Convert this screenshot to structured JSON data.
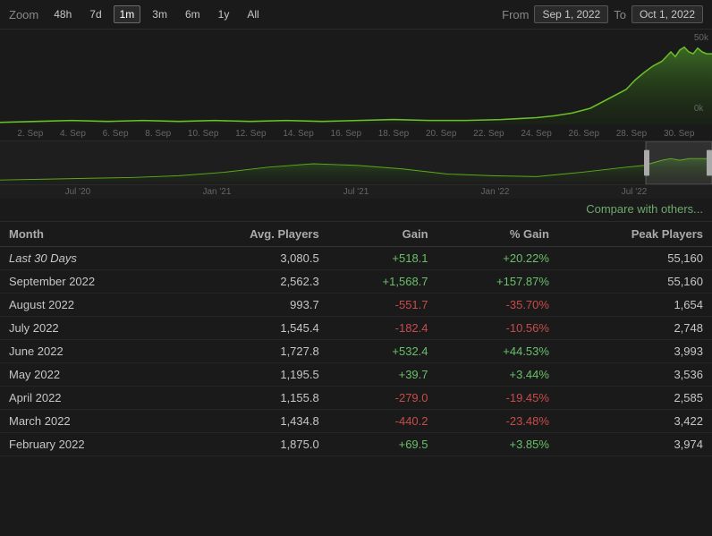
{
  "topbar": {
    "zoom_label": "Zoom",
    "zoom_buttons": [
      "48h",
      "7d",
      "1m",
      "3m",
      "6m",
      "1y",
      "All"
    ],
    "active_zoom": "1m",
    "from_label": "From",
    "to_label": "To",
    "from_date": "Sep 1, 2022",
    "to_date": "Oct 1, 2022"
  },
  "x_labels": [
    "2. Sep",
    "4. Sep",
    "6. Sep",
    "8. Sep",
    "10. Sep",
    "12. Sep",
    "14. Sep",
    "16. Sep",
    "18. Sep",
    "20. Sep",
    "22. Sep",
    "24. Sep",
    "26. Sep",
    "28. Sep",
    "30. Sep"
  ],
  "y_labels": [
    "50k",
    "0k"
  ],
  "nav_labels": [
    "Jul '20",
    "Jan '21",
    "Jul '21",
    "Jan '22",
    "Jul '22"
  ],
  "compare_label": "Compare with others...",
  "table": {
    "headers": [
      "Month",
      "Avg. Players",
      "Gain",
      "% Gain",
      "Peak Players"
    ],
    "rows": [
      {
        "month": "Last 30 Days",
        "italic": true,
        "avg": "3,080.5",
        "gain": "+518.1",
        "gain_pct": "+20.22%",
        "peak": "55,160",
        "gain_pos": true,
        "pct_pos": true
      },
      {
        "month": "September 2022",
        "italic": false,
        "avg": "2,562.3",
        "gain": "+1,568.7",
        "gain_pct": "+157.87%",
        "peak": "55,160",
        "gain_pos": true,
        "pct_pos": true
      },
      {
        "month": "August 2022",
        "italic": false,
        "avg": "993.7",
        "gain": "-551.7",
        "gain_pct": "-35.70%",
        "peak": "1,654",
        "gain_pos": false,
        "pct_pos": false
      },
      {
        "month": "July 2022",
        "italic": false,
        "avg": "1,545.4",
        "gain": "-182.4",
        "gain_pct": "-10.56%",
        "peak": "2,748",
        "gain_pos": false,
        "pct_pos": false
      },
      {
        "month": "June 2022",
        "italic": false,
        "avg": "1,727.8",
        "gain": "+532.4",
        "gain_pct": "+44.53%",
        "peak": "3,993",
        "gain_pos": true,
        "pct_pos": true
      },
      {
        "month": "May 2022",
        "italic": false,
        "avg": "1,195.5",
        "gain": "+39.7",
        "gain_pct": "+3.44%",
        "peak": "3,536",
        "gain_pos": true,
        "pct_pos": true
      },
      {
        "month": "April 2022",
        "italic": false,
        "avg": "1,155.8",
        "gain": "-279.0",
        "gain_pct": "-19.45%",
        "peak": "2,585",
        "gain_pos": false,
        "pct_pos": false
      },
      {
        "month": "March 2022",
        "italic": false,
        "avg": "1,434.8",
        "gain": "-440.2",
        "gain_pct": "-23.48%",
        "peak": "3,422",
        "gain_pos": false,
        "pct_pos": false
      },
      {
        "month": "February 2022",
        "italic": false,
        "avg": "1,875.0",
        "gain": "+69.5",
        "gain_pct": "+3.85%",
        "peak": "3,974",
        "gain_pos": true,
        "pct_pos": true
      }
    ]
  }
}
